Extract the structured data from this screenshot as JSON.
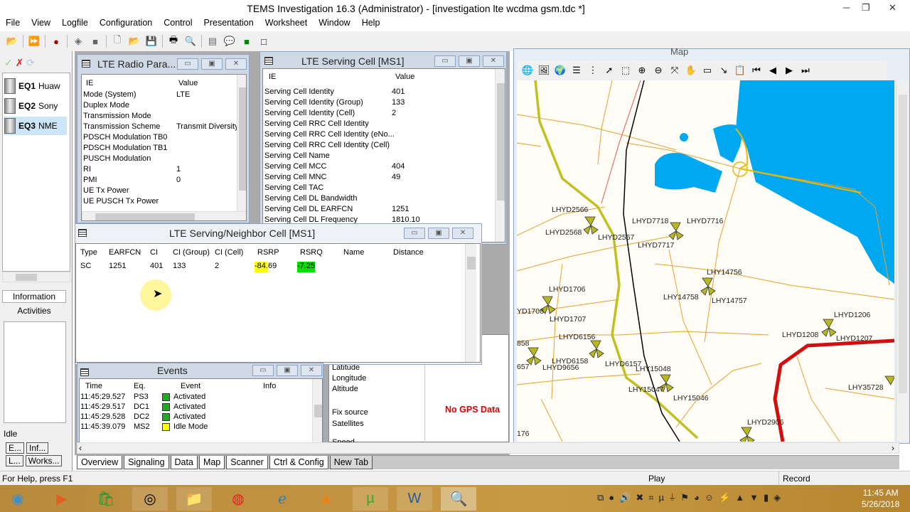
{
  "window": {
    "title": "TEMS Investigation 16.3 (Administrator) - [investigation lte wcdma gsm.tdc *]"
  },
  "menu": [
    "File",
    "View",
    "Logfile",
    "Configuration",
    "Control",
    "Presentation",
    "Worksheet",
    "Window",
    "Help"
  ],
  "equipment": [
    {
      "id": "EQ1",
      "name": "Huaw"
    },
    {
      "id": "EQ2",
      "name": "Sony"
    },
    {
      "id": "EQ3",
      "name": "NME"
    }
  ],
  "left": {
    "information": "Information",
    "activities": "Activities",
    "idle": "Idle",
    "tabs": [
      "E...",
      "Inf...",
      "L...",
      "Works..."
    ]
  },
  "radio": {
    "title": "LTE Radio Para...",
    "col_ie": "IE",
    "col_value": "Value",
    "rows": [
      [
        "Mode (System)",
        "LTE"
      ],
      [
        "Duplex Mode",
        ""
      ],
      [
        "Transmission Mode",
        ""
      ],
      [
        "Transmission Scheme",
        "Transmit Diversity"
      ],
      [
        "PDSCH Modulation TB0",
        ""
      ],
      [
        "PDSCH Modulation TB1",
        ""
      ],
      [
        "PUSCH Modulation",
        ""
      ],
      [
        "RI",
        "1"
      ],
      [
        "PMI",
        "0"
      ],
      [
        "UE Tx Power",
        ""
      ],
      [
        "UE PUSCH Tx Power",
        ""
      ]
    ]
  },
  "serving": {
    "title": "LTE Serving Cell [MS1]",
    "col_ie": "IE",
    "col_value": "Value",
    "rows": [
      [
        "Serving Cell Identity",
        "401"
      ],
      [
        "Serving Cell Identity (Group)",
        "133"
      ],
      [
        "Serving Cell Identity (Cell)",
        "2"
      ],
      [
        "Serving Cell RRC Cell Identity",
        ""
      ],
      [
        "Serving Cell RRC Cell Identity (eNo...",
        ""
      ],
      [
        "Serving Cell RRC Cell Identity (Cell)",
        ""
      ],
      [
        "Serving Cell Name",
        ""
      ],
      [
        "Serving Cell MCC",
        "404"
      ],
      [
        "Serving Cell MNC",
        "49"
      ],
      [
        "Serving Cell TAC",
        ""
      ],
      [
        "Serving Cell DL Bandwidth",
        ""
      ],
      [
        "Serving Cell DL EARFCN",
        "1251"
      ],
      [
        "Serving Cell DL Frequency",
        "1810.10"
      ]
    ]
  },
  "neighbor": {
    "title": "LTE Serving/Neighbor Cell [MS1]",
    "columns": [
      "Type",
      "EARFCN",
      "CI",
      "CI (Group)",
      "CI (Cell)",
      "RSRP",
      "RSRQ",
      "Name",
      "Distance"
    ],
    "rows": [
      {
        "type": "SC",
        "earfcn": "1251",
        "ci": "401",
        "group": "133",
        "cell": "2",
        "rsrp": "-84.69",
        "rsrq": "-7.25",
        "name": "",
        "distance": ""
      }
    ],
    "rsrp_color": "#ffff00",
    "rsrq_color": "#00e000"
  },
  "events": {
    "title": "Events",
    "columns": [
      "Time",
      "Eq.",
      "Event",
      "Info"
    ],
    "rows": [
      [
        "11:45:29.527",
        "PS3",
        "Activated"
      ],
      [
        "11:45:29.517",
        "DC1",
        "Activated"
      ],
      [
        "11:45:29.528",
        "DC2",
        "Activated"
      ],
      [
        "11:45:39.079",
        "MS2",
        "Idle Mode"
      ]
    ]
  },
  "gps": {
    "labels": [
      "Latitude",
      "Longitude",
      "Altitude",
      "Fix source",
      "Satellites",
      "Speed"
    ],
    "no_data": "No GPS Data"
  },
  "map": {
    "title": "Map",
    "sites": [
      "LHYD2566",
      "LHYD2568",
      "LHYD2567",
      "LHYD7718",
      "LHYD7716",
      "LHYD7717",
      "LHY14756",
      "LHY14758",
      "LHY14757",
      "LHYD1706",
      "YD1708",
      "LHYD1707",
      "LHYD1206",
      "LHYD1208",
      "LHYD1207",
      "LHYD6156",
      "858",
      "LHYD6158",
      "LHYD9656",
      "LHYD6157",
      "657",
      "LHY15048",
      "LHY15047",
      "LHY15046",
      "LHY35728",
      "LHYD2906",
      "176"
    ]
  },
  "tabs": [
    "Overview",
    "Signaling",
    "Data",
    "Map",
    "Scanner",
    "Ctrl & Config",
    "New Tab"
  ],
  "status": {
    "help": "For Help, press F1",
    "play": "Play",
    "record": "Record"
  },
  "clock": {
    "time": "11:45 AM",
    "date": "5/26/2018"
  }
}
